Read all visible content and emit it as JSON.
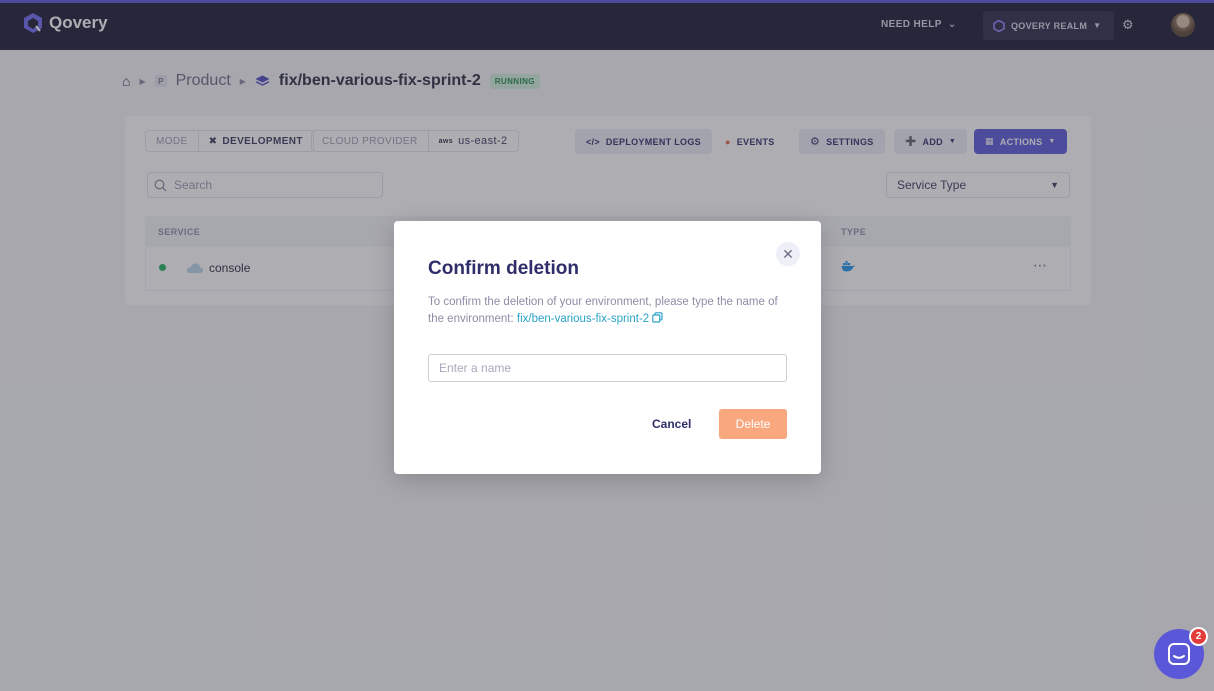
{
  "nav": {
    "logo_text": "Qovery",
    "need_help": "NEED HELP",
    "organization": "QOVERY REALM"
  },
  "breadcrumb": {
    "project_badge": "P",
    "project": "Product",
    "environment": "fix/ben-various-fix-sprint-2",
    "status": "RUNNING"
  },
  "toolbar": {
    "mode_label": "MODE",
    "mode_value": "DEVELOPMENT",
    "cloud_label": "CLOUD PROVIDER",
    "cloud_value": "us-east-2",
    "cloud_badge": "aws",
    "deployment_logs": "DEPLOYMENT LOGS",
    "events": "EVENTS",
    "settings": "SETTINGS",
    "add": "ADD",
    "actions": "ACTIONS"
  },
  "filters": {
    "search_placeholder": "Search",
    "service_type": "Service Type"
  },
  "table": {
    "columns": [
      "SERVICE",
      "TYPE"
    ],
    "rows": [
      {
        "name": "console",
        "status_color": "#22b35e",
        "type_icon": "docker-icon"
      }
    ]
  },
  "modal": {
    "title": "Confirm deletion",
    "description": "To confirm the deletion of your environment, please type the name of the environment:",
    "env_name": "fix/ben-various-fix-sprint-2",
    "input_placeholder": "Enter a name",
    "cancel": "Cancel",
    "delete": "Delete"
  },
  "chat": {
    "badge_count": "2"
  },
  "colors": {
    "primary": "#5b57d9",
    "nav_bg": "#191832",
    "delete": "#f9a77f",
    "link": "#2aa3c9",
    "running": "#1f8a4c"
  }
}
